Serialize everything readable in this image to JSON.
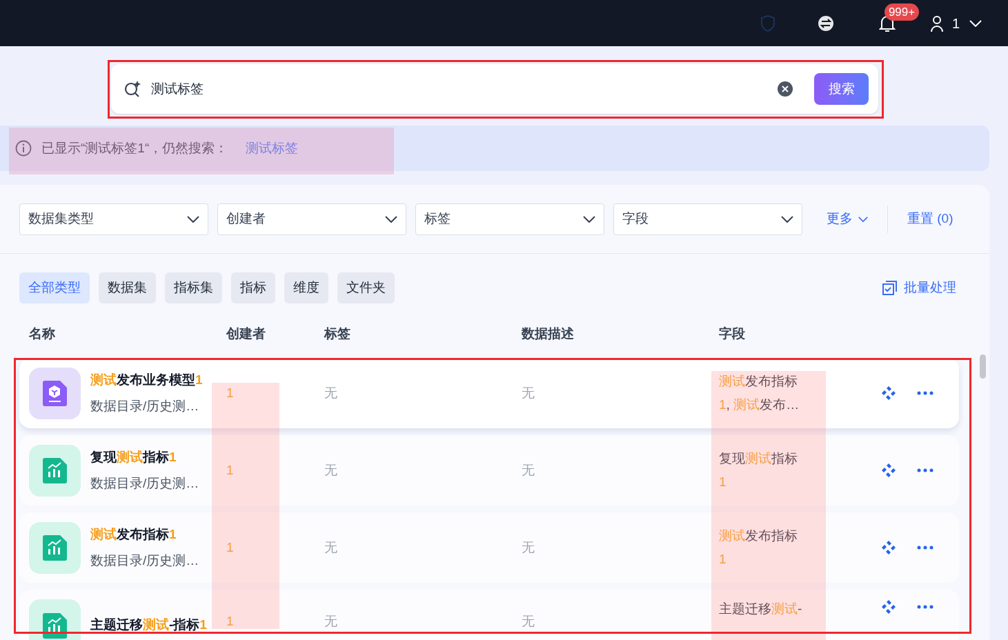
{
  "top_bar": {
    "notification_badge": "999+",
    "user_name": "1"
  },
  "search": {
    "value": "测试标签",
    "button": "搜索"
  },
  "notice": {
    "text": "已显示“测试标签1“，仍然搜索：",
    "link": "测试标签"
  },
  "filters": [
    {
      "label": "数据集类型"
    },
    {
      "label": "创建者"
    },
    {
      "label": "标签"
    },
    {
      "label": "字段"
    }
  ],
  "more": "更多",
  "reset": "重置 (0)",
  "type_tabs": [
    {
      "label": "全部类型",
      "selected": true
    },
    {
      "label": "数据集",
      "selected": false
    },
    {
      "label": "指标集",
      "selected": false
    },
    {
      "label": "指标",
      "selected": false
    },
    {
      "label": "维度",
      "selected": false
    },
    {
      "label": "文件夹",
      "selected": false
    }
  ],
  "batch": "批量处理",
  "table": {
    "columns": [
      "名称",
      "创建者",
      "标签",
      "数据描述",
      "字段"
    ],
    "rows": [
      {
        "kind": "model",
        "highlighted": true,
        "name": [
          {
            "text": "测试",
            "hit": true
          },
          {
            "text": "发布业务模型",
            "hit": false
          },
          {
            "text": "1",
            "hit": true
          }
        ],
        "path": "数据目录/历史测…",
        "creator": "1",
        "tag": "无",
        "description": "无",
        "field": [
          [
            {
              "text": "测试",
              "hit": true
            },
            {
              "text": "发布指标",
              "hit": false
            }
          ],
          [
            {
              "text": "1",
              "hit": true
            },
            {
              "text": ", ",
              "hit": false
            },
            {
              "text": "测试",
              "hit": true
            },
            {
              "text": "发布…",
              "hit": false
            }
          ]
        ]
      },
      {
        "kind": "metric",
        "highlighted": false,
        "name": [
          {
            "text": "复现",
            "hit": false
          },
          {
            "text": "测试",
            "hit": true
          },
          {
            "text": "指标",
            "hit": false
          },
          {
            "text": "1",
            "hit": true
          }
        ],
        "path": "数据目录/历史测…",
        "creator": "1",
        "tag": "无",
        "description": "无",
        "field": [
          [
            {
              "text": "复现",
              "hit": false
            },
            {
              "text": "测试",
              "hit": true
            },
            {
              "text": "指标",
              "hit": false
            }
          ],
          [
            {
              "text": "1",
              "hit": true
            }
          ]
        ]
      },
      {
        "kind": "metric",
        "highlighted": false,
        "name": [
          {
            "text": "测试",
            "hit": true
          },
          {
            "text": "发布指标",
            "hit": false
          },
          {
            "text": "1",
            "hit": true
          }
        ],
        "path": "数据目录/历史测…",
        "creator": "1",
        "tag": "无",
        "description": "无",
        "field": [
          [
            {
              "text": "测试",
              "hit": true
            },
            {
              "text": "发布指标",
              "hit": false
            }
          ],
          [
            {
              "text": "1",
              "hit": true
            }
          ]
        ]
      },
      {
        "kind": "metric",
        "highlighted": false,
        "name": [
          {
            "text": "主题迁移",
            "hit": false
          },
          {
            "text": "测试",
            "hit": true
          },
          {
            "text": "-指标",
            "hit": false
          },
          {
            "text": "1",
            "hit": true
          }
        ],
        "creator": "1",
        "tag": "无",
        "description": "无",
        "field": [
          [
            {
              "text": "主题迁移",
              "hit": false
            },
            {
              "text": "测试",
              "hit": true
            },
            {
              "text": "-",
              "hit": false
            }
          ]
        ]
      }
    ]
  }
}
